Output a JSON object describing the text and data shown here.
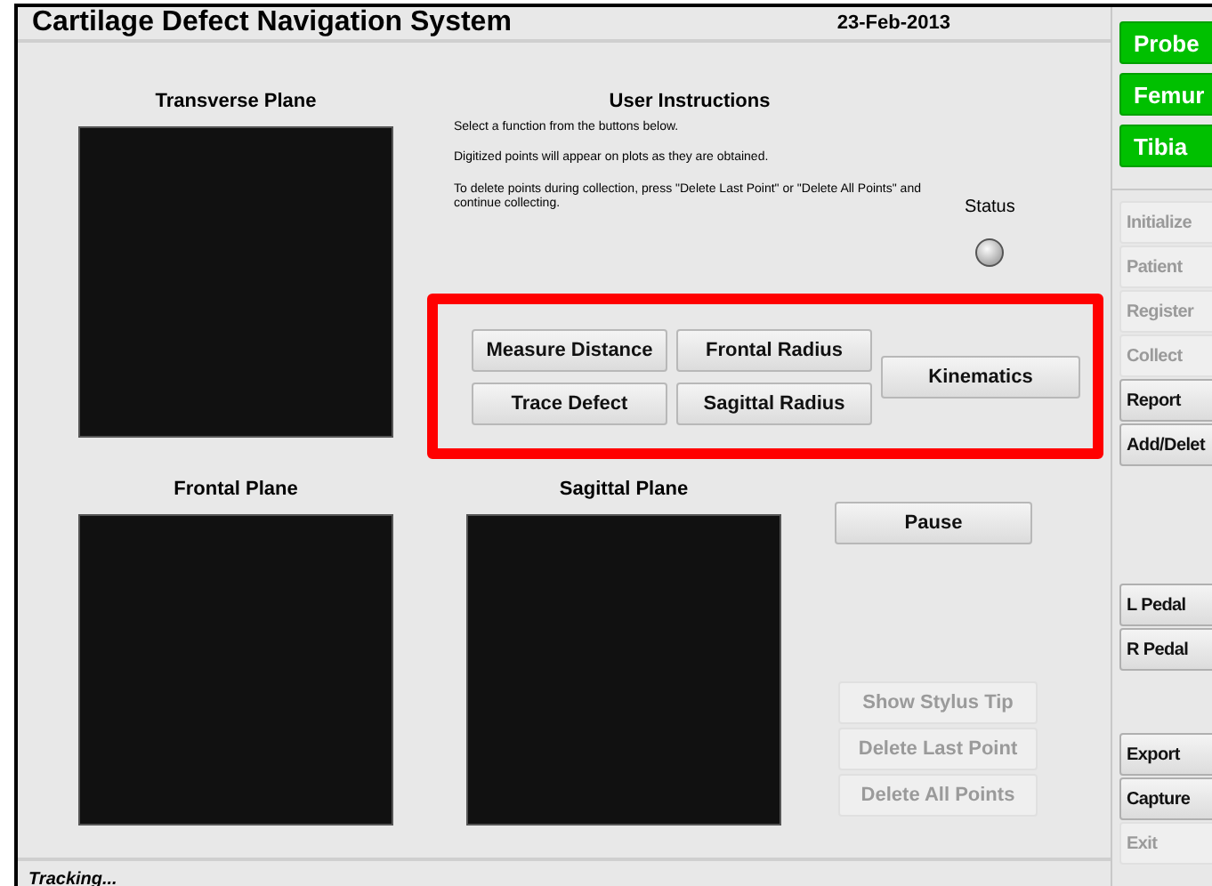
{
  "header": {
    "title": "Cartilage Defect Navigation System",
    "date": "23-Feb-2013"
  },
  "plots": {
    "transverse": "Transverse Plane",
    "frontal": "Frontal Plane",
    "sagittal": "Sagittal Plane"
  },
  "instructions": {
    "title": "User Instructions",
    "lines": [
      "Select a function from the buttons below.",
      "Digitized points will appear on plots as they are obtained.",
      "To delete points during collection, press \"Delete Last Point\" or \"Delete All Points\" and continue collecting."
    ]
  },
  "status": {
    "label": "Status",
    "on": false
  },
  "functions": {
    "highlighted": true,
    "left": [
      "Measure Distance",
      "Trace Defect"
    ],
    "middle": [
      "Frontal Radius",
      "Sagittal Radius"
    ],
    "right": "Kinematics"
  },
  "pause": {
    "label": "Pause",
    "disabled": false
  },
  "point_buttons": [
    {
      "label": "Show Stylus Tip",
      "disabled": true
    },
    {
      "label": "Delete Last Point",
      "disabled": true
    },
    {
      "label": "Delete All Points",
      "disabled": true
    }
  ],
  "sidebar": [
    {
      "label": "Probe",
      "kind": "tracker",
      "disabled": false
    },
    {
      "label": "Femur",
      "kind": "tracker",
      "disabled": false
    },
    {
      "label": "Tibia",
      "kind": "tracker",
      "disabled": false
    },
    {
      "label": "Initialize",
      "kind": "step",
      "disabled": true
    },
    {
      "label": "Patient",
      "kind": "step",
      "disabled": true
    },
    {
      "label": "Register",
      "kind": "step",
      "disabled": true
    },
    {
      "label": "Collect",
      "kind": "step",
      "disabled": true
    },
    {
      "label": "Report",
      "kind": "step",
      "disabled": false
    },
    {
      "label": "Add/Delet",
      "kind": "step",
      "disabled": false
    },
    {
      "label": "L Pedal",
      "kind": "pedal",
      "disabled": false
    },
    {
      "label": "R Pedal",
      "kind": "pedal",
      "disabled": false
    },
    {
      "label": "Export",
      "kind": "file",
      "disabled": false
    },
    {
      "label": "Capture",
      "kind": "file",
      "disabled": false
    },
    {
      "label": "Exit",
      "kind": "file",
      "disabled": true
    }
  ],
  "status_bar": "Tracking..."
}
